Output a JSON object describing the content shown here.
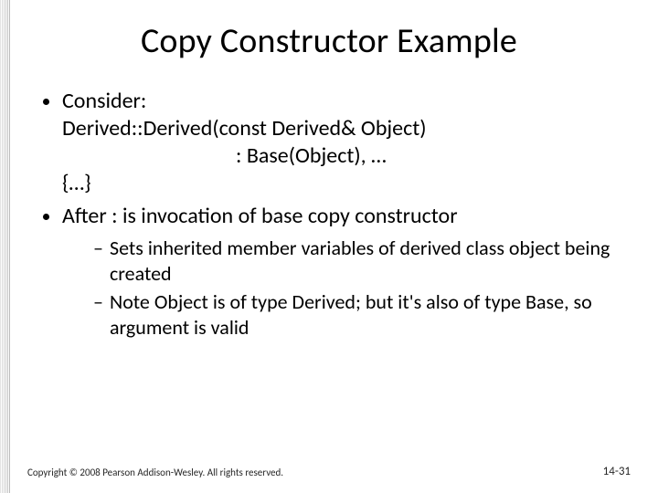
{
  "title": "Copy Constructor Example",
  "bullets": {
    "b1_lead": "Consider:",
    "b1_line1": "Derived::Derived(const Derived& Object)",
    "b1_line2": ": Base(Object), …",
    "b1_line3": "{…}",
    "b2": "After : is invocation of base copy constructor",
    "sub1": "Sets inherited member variables of derived class object being created",
    "sub2": "Note Object is of type Derived; but it's also of type Base, so argument is valid"
  },
  "footer": {
    "copyright": "Copyright © 2008 Pearson Addison-Wesley. All rights reserved.",
    "page": "14-31"
  }
}
